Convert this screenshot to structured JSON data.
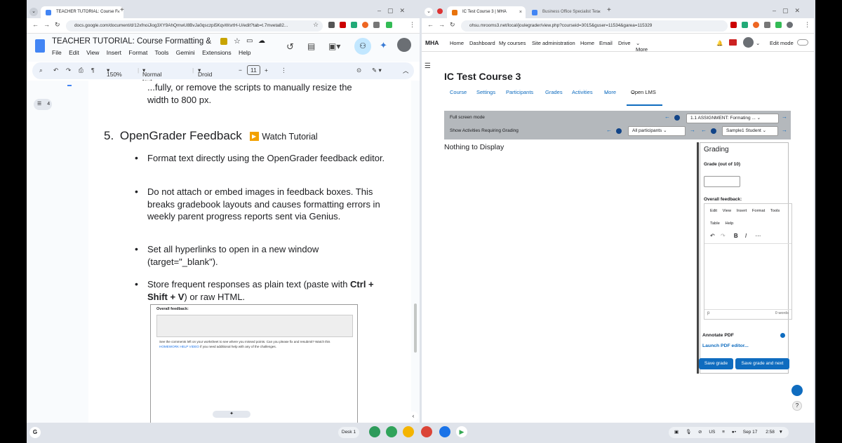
{
  "left_window": {
    "tab": {
      "title": "TEACHER TUTORIAL: Course F",
      "close": "×"
    },
    "new_tab": "+",
    "url": "docs.google.com/document/d/12xfnoiJiog3XY9AhQmwU8BvJa0qsczpi5KqvWsrtH-U/edit?tab=t.7mveta82...",
    "doc_title": "TEACHER TUTORIAL: Course Formatting & HT...",
    "menus": [
      "File",
      "Edit",
      "View",
      "Insert",
      "Format",
      "Tools",
      "Gemini",
      "Extensions",
      "Help"
    ],
    "toolbar": {
      "zoom": "150%",
      "style": "Normal text",
      "font": "Droid ...",
      "size": "11",
      "minus": "−",
      "plus": "+"
    },
    "outline_count": "4",
    "doc": {
      "cut_line": "...fully, or remove the scripts to manually resize the",
      "cut_line2": "width to 800 px.",
      "heading_number": "5.",
      "heading": "OpenGrader Feedback",
      "watch": "Watch Tutorial",
      "bullets": [
        "Format text directly using the OpenGrader feedback editor.",
        "Do not attach or embed images in feedback boxes. This breaks gradebook layouts and causes formatting errors in weekly parent progress reports sent via Genius.",
        "Set all hyperlinks to open in a new window (target=\"_blank\")."
      ],
      "bullet4_pre": "Store frequent responses as plain text (paste with ",
      "bullet4_bold": "Ctrl + Shift + V",
      "bullet4_post": ") or raw HTML.",
      "embedded": {
        "label": "Overall feedback:",
        "text_pre": "See the comments left on your worksheet to see where you missed points. Can you please fix and resubmit? Watch this ",
        "link": "HOMEWORK HELP VIDEO",
        "text_post": " if you need additional help with any of the challenges."
      }
    }
  },
  "right_window": {
    "tabs": [
      {
        "title": "IC Test Course 3 | MHA",
        "close": "×"
      },
      {
        "title": "Business Office Specialist Tes",
        "close": "×"
      }
    ],
    "new_tab": "+",
    "url": "ohsu.mrooms3.net/local/joulegrader/view.php?courseid=3015&guser=11534&garea=115329",
    "site_name": "MHA",
    "primary_nav": [
      "Home",
      "Dashboard",
      "My courses",
      "Site administration",
      "Home",
      "Email",
      "Drive",
      "More"
    ],
    "edit_mode": "Edit mode",
    "course_title": "IC Test Course 3",
    "secondary_nav": [
      "Course",
      "Settings",
      "Participants",
      "Grades",
      "Activities",
      "More",
      "Open LMS"
    ],
    "grader": {
      "full_screen": "Full screen mode",
      "show_activities": "Show Activities Requiring Grading",
      "assignment": "1.1 ASSIGNMENT: Formating ...",
      "participants": "All participants",
      "student": "Sample1 Student",
      "nothing": "Nothing to Display",
      "panel_title": "Grading",
      "grade_label": "Grade (out of 10)",
      "overall_label": "Overall feedback:",
      "editor_menus": [
        "Edit",
        "View",
        "Insert",
        "Format",
        "Tools"
      ],
      "editor_menus2": [
        "Table",
        "Help"
      ],
      "status_p": "p",
      "word_count": "0 words",
      "annotate": "Annotate PDF",
      "launch": "Launch PDF editor...",
      "save": "Save grade",
      "save_next": "Save grade and next"
    }
  },
  "shelf": {
    "desk": "Desk 1",
    "date": "Sep 17",
    "time": "2:58",
    "lang": "US"
  }
}
